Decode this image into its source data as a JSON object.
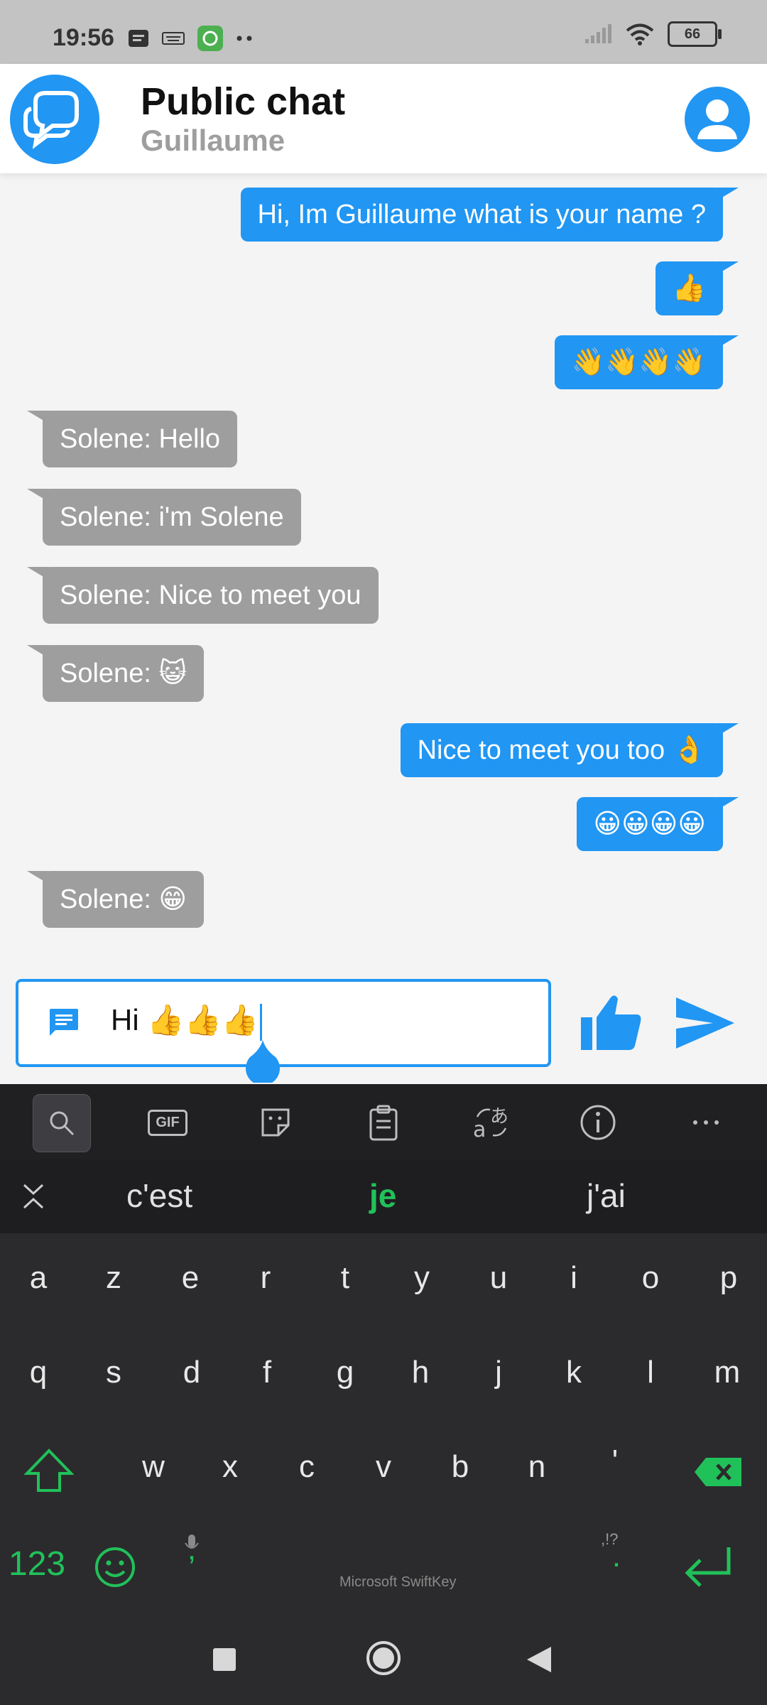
{
  "status_bar": {
    "time": "19:56",
    "battery": "66"
  },
  "header": {
    "title": "Public chat",
    "subtitle": "Guillaume"
  },
  "messages": [
    {
      "dir": "out",
      "text": "Hi, Im Guillaume what is your name ?"
    },
    {
      "dir": "out",
      "text": "👍"
    },
    {
      "dir": "out",
      "text": "👋👋👋👋"
    },
    {
      "dir": "in",
      "text": "Solene: Hello"
    },
    {
      "dir": "in",
      "text": "Solene: i'm Solene"
    },
    {
      "dir": "in",
      "text": "Solene: Nice to meet you"
    },
    {
      "dir": "in",
      "text": "Solene: 😺"
    },
    {
      "dir": "out",
      "text": "Nice to meet you too 👌"
    },
    {
      "dir": "out",
      "text": "😀😀😀😀"
    },
    {
      "dir": "in",
      "text": "Solene: 😁"
    }
  ],
  "composer": {
    "value": "Hi 👍👍👍"
  },
  "keyboard": {
    "toolbar": [
      "search-icon",
      "gif-icon",
      "sticker-icon",
      "clipboard-icon",
      "translate-icon",
      "info-icon",
      "more-icon"
    ],
    "gif_label": "GIF",
    "suggestions": [
      "c'est",
      "je",
      "j'ai"
    ],
    "row1": [
      "a",
      "z",
      "e",
      "r",
      "t",
      "y",
      "u",
      "i",
      "o",
      "p"
    ],
    "row2": [
      "q",
      "s",
      "d",
      "f",
      "g",
      "h",
      "j",
      "k",
      "l",
      "m"
    ],
    "row3": [
      "w",
      "x",
      "c",
      "v",
      "b",
      "n",
      "'"
    ],
    "num_key": "123",
    "comma": ",",
    "period": ".",
    "punct_hint": ",!?",
    "brand": "Microsoft SwiftKey"
  },
  "colors": {
    "accent": "#2196f3",
    "incoming": "#9e9e9e",
    "keyboard_green": "#21c15a"
  }
}
